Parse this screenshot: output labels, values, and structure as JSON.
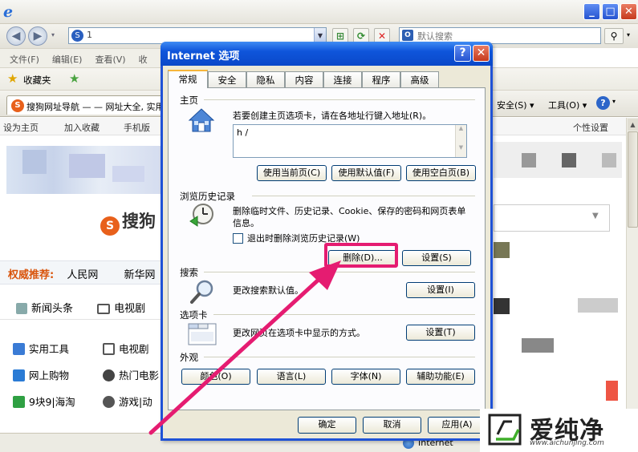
{
  "browser": {
    "address_url": "1",
    "search_placeholder": "默认搜索",
    "menu": [
      "文件(F)",
      "编辑(E)",
      "查看(V)",
      "收"
    ],
    "favorites_label": "收藏夹",
    "tab_title": "搜狗网址导航 — — 网址大全, 实用",
    "tools_right": {
      "security": "安全(S) ▾",
      "tools": "工具(O) ▾",
      "help": "?"
    },
    "status_zone": "Internet"
  },
  "page": {
    "nav": {
      "set_home": "设为主页",
      "add_fav": "加入收藏",
      "mobile": "手机版",
      "personal": "个性设置"
    },
    "logo_text": "搜狗",
    "recommend_title": "权威推荐:",
    "recommend_links": [
      "人民网",
      "新华网"
    ],
    "news_row": {
      "news": "新闻头条",
      "tv": "电视剧"
    },
    "categories": [
      {
        "label": "实用工具",
        "icon": "tools-icon",
        "color": "#3a7bd5"
      },
      {
        "label": "电视剧",
        "icon": "tv-icon",
        "color": "#555"
      },
      {
        "label": "网上购物",
        "icon": "shopping-icon",
        "color": "#2a7bd5"
      },
      {
        "label": "热门电影",
        "icon": "film-icon",
        "color": "#444"
      },
      {
        "label": "9块9|海淘",
        "icon": "bag-icon",
        "color": "#2fa043"
      },
      {
        "label": "游戏|动",
        "icon": "game-icon",
        "color": "#555"
      }
    ]
  },
  "dialog": {
    "title": "Internet 选项",
    "help_btn": "?",
    "close_btn": "✕",
    "tabs": [
      "常规",
      "安全",
      "隐私",
      "内容",
      "连接",
      "程序",
      "高级"
    ],
    "home": {
      "section": "主页",
      "desc": "若要创建主页选项卡，请在各地址行键入地址(R)。",
      "value": "h                    /",
      "btn_current": "使用当前页(C)",
      "btn_default": "使用默认值(F)",
      "btn_blank": "使用空白页(B)"
    },
    "history": {
      "section": "浏览历史记录",
      "desc": "删除临时文件、历史记录、Cookie、保存的密码和网页表单信息。",
      "checkbox": "退出时删除浏览历史记录(W)",
      "btn_delete": "删除(D)...",
      "btn_settings": "设置(S)"
    },
    "search": {
      "section": "搜索",
      "desc": "更改搜索默认值。",
      "btn": "设置(I)"
    },
    "tabs_section": {
      "section": "选项卡",
      "desc": "更改网页在选项卡中显示的方式。",
      "btn": "设置(T)"
    },
    "appearance": {
      "section": "外观",
      "btn_colors": "颜色(O)",
      "btn_lang": "语言(L)",
      "btn_fonts": "字体(N)",
      "btn_access": "辅助功能(E)"
    },
    "footer": {
      "ok": "确定",
      "cancel": "取消",
      "apply": "应用(A)"
    }
  },
  "watermark": {
    "text": "爱纯净",
    "url": "www.aichunjing.com"
  },
  "colors": {
    "highlight": "#e51c71",
    "xp_blue": "#0f55db",
    "dialog_bg": "#ece9d8"
  }
}
